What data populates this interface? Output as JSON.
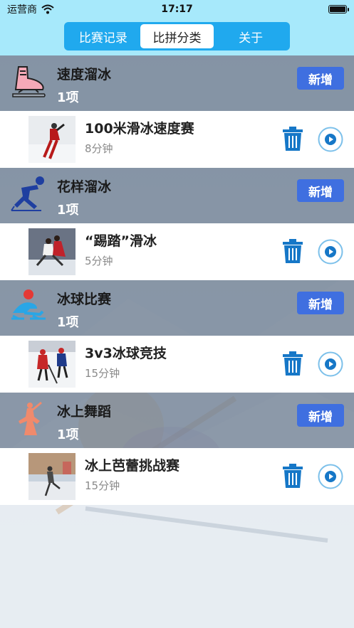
{
  "status": {
    "carrier": "运营商",
    "time": "17:17"
  },
  "tabs": [
    {
      "label": "比赛记录",
      "active": false
    },
    {
      "label": "比拼分类",
      "active": true
    },
    {
      "label": "关于",
      "active": false
    }
  ],
  "categories": [
    {
      "name": "速度溜冰",
      "count": "1项",
      "add_label": "新增",
      "icon": "skate-boot-icon",
      "item": {
        "title": "100米滑冰速度赛",
        "duration": "8分钟"
      }
    },
    {
      "name": "花样溜冰",
      "count": "1项",
      "add_label": "新增",
      "icon": "skater-icon",
      "item": {
        "title": "“踢踏”滑冰",
        "duration": "5分钟"
      }
    },
    {
      "name": "冰球比赛",
      "count": "1项",
      "add_label": "新增",
      "icon": "hockey-player-icon",
      "item": {
        "title": "3v3冰球竞技",
        "duration": "15分钟"
      }
    },
    {
      "name": "冰上舞蹈",
      "count": "1项",
      "add_label": "新增",
      "icon": "dancer-icon",
      "item": {
        "title": "冰上芭蕾挑战赛",
        "duration": "15分钟"
      }
    }
  ],
  "colors": {
    "nav_bg": "#a7e9fb",
    "segment_bg": "#20a9ee",
    "add_button": "#3f6fe0",
    "icon_blue": "#1677c7"
  }
}
